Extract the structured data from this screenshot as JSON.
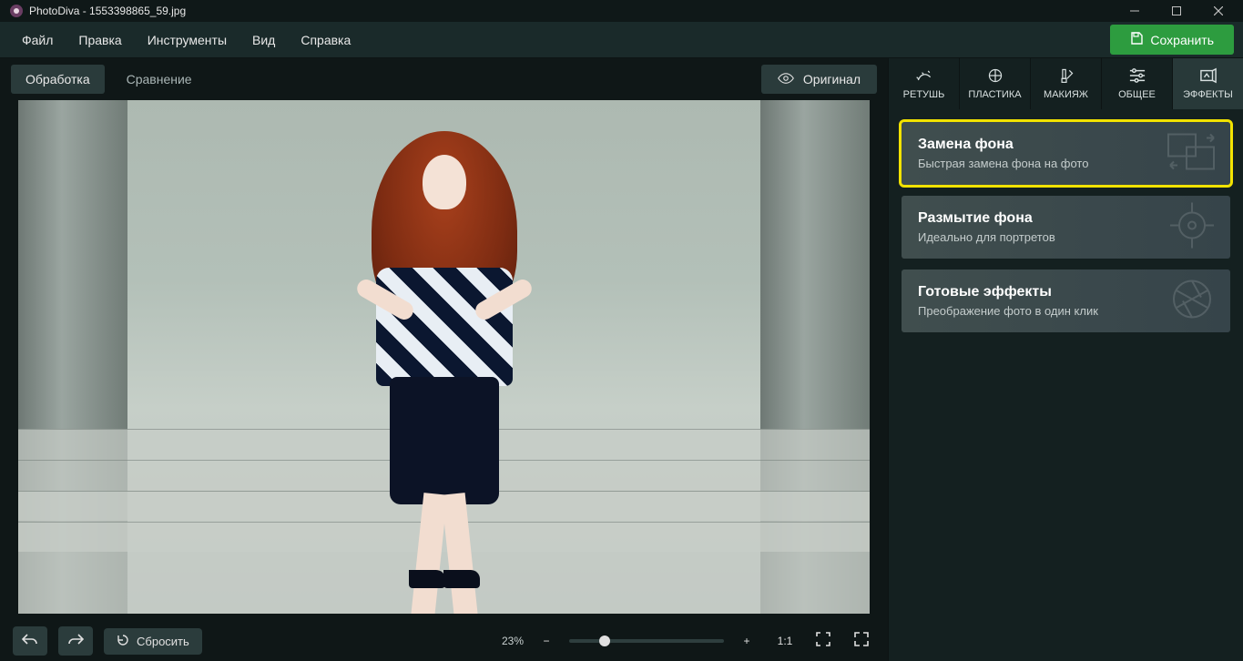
{
  "window": {
    "title": "PhotoDiva - 1553398865_59.jpg"
  },
  "menu": {
    "items": [
      "Файл",
      "Правка",
      "Инструменты",
      "Вид",
      "Справка"
    ],
    "save": "Сохранить"
  },
  "toolbar": {
    "process": "Обработка",
    "compare": "Сравнение",
    "original": "Оригинал"
  },
  "bottom": {
    "reset": "Сбросить",
    "zoom_value": "23%",
    "ratio": "1:1"
  },
  "tabs": [
    {
      "id": "retouch",
      "label": "РЕТУШЬ"
    },
    {
      "id": "plastic",
      "label": "ПЛАСТИКА"
    },
    {
      "id": "makeup",
      "label": "МАКИЯЖ"
    },
    {
      "id": "general",
      "label": "ОБЩЕЕ"
    },
    {
      "id": "effects",
      "label": "ЭФФЕКТЫ"
    }
  ],
  "effects": [
    {
      "title": "Замена фона",
      "desc": "Быстрая замена фона на фото",
      "highlight": true,
      "glyph": "swap"
    },
    {
      "title": "Размытие фона",
      "desc": "Идеально для портретов",
      "highlight": false,
      "glyph": "focus"
    },
    {
      "title": "Готовые эффекты",
      "desc": "Преображение фото в один клик",
      "highlight": false,
      "glyph": "aperture"
    }
  ]
}
